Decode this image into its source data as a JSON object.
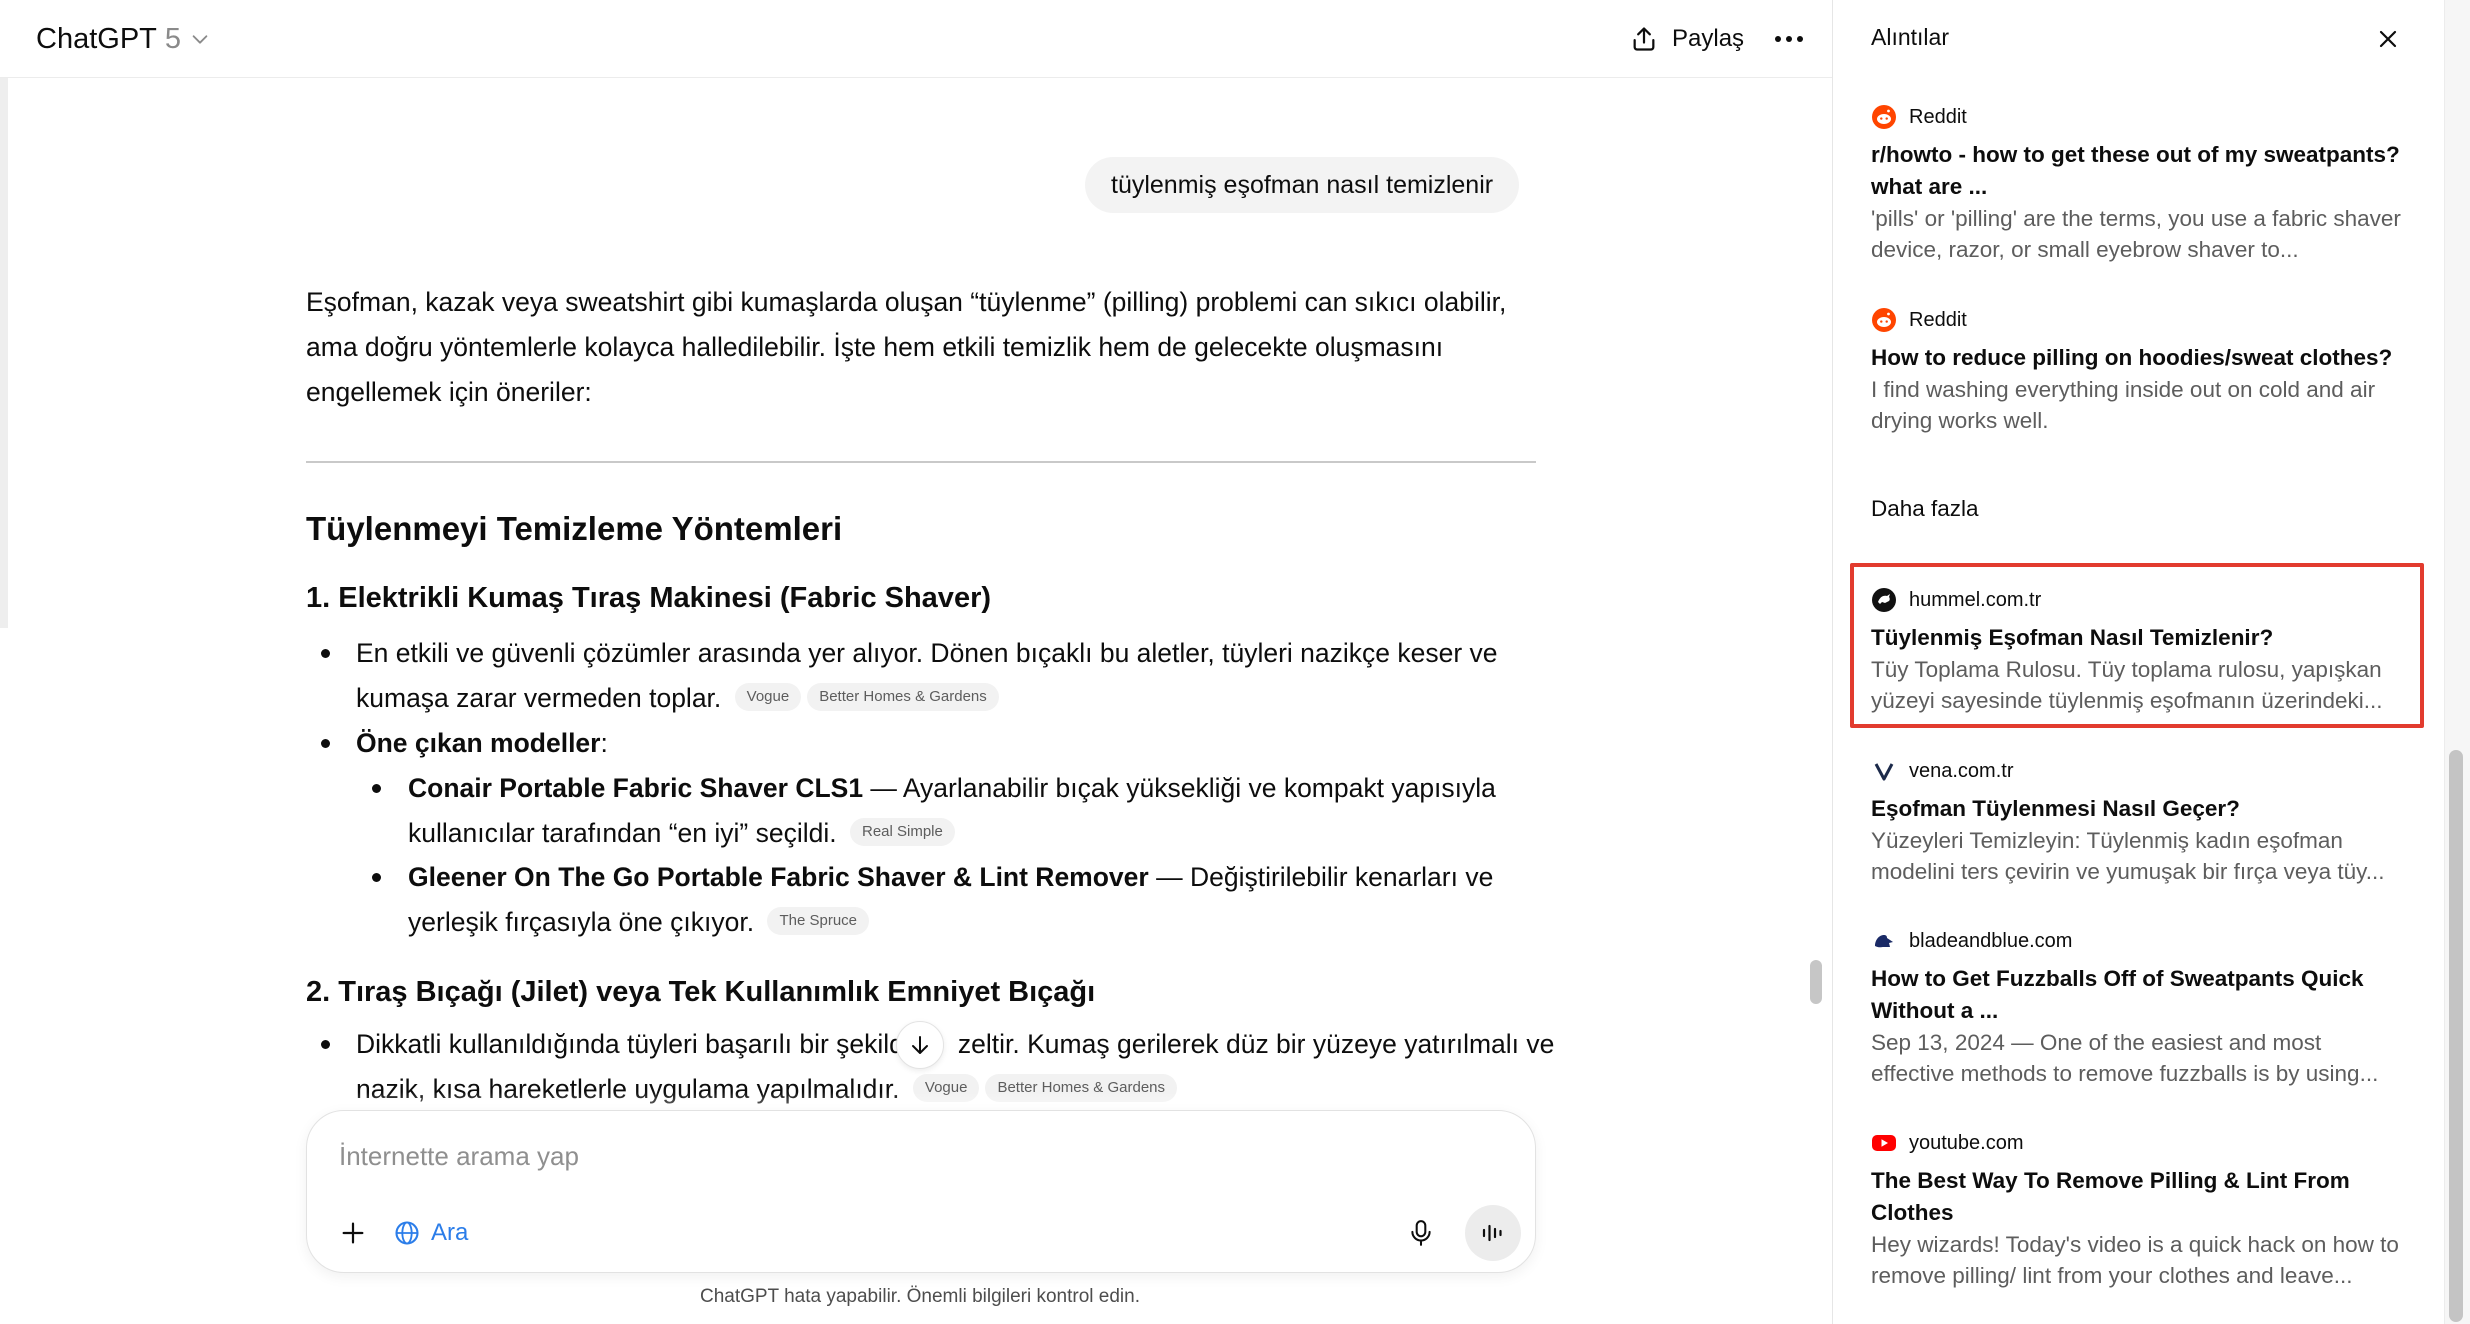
{
  "header": {
    "app_name": "ChatGPT",
    "model_version": "5",
    "share_label": "Paylaş"
  },
  "conversation": {
    "user_message": "tüylenmiş eşofman nasıl temizlenir",
    "intro_lines": [
      "Eşofman, kazak veya sweatshirt gibi kumaşlarda oluşan “tüylenme” (pilling) problemi can sıkıcı olabilir,",
      "ama doğru yöntemlerle kolayca halledilebilir. İşte hem etkili temizlik hem de gelecekte oluşmasını",
      "engellemek için öneriler:"
    ],
    "section_heading": "Tüylenmeyi Temizleme Yöntemleri",
    "method1": {
      "heading": "1. Elektrikli Kumaş Tıraş Makinesi (Fabric Shaver)",
      "bullet1_line1": "En etkili ve güvenli çözümler arasında yer alıyor. Dönen bıçaklı bu aletler, tüyleri nazikçe keser ve",
      "bullet1_line2": "kumaşa zarar vermeden toplar.",
      "bullet1_chips": [
        "Vogue",
        "Better Homes & Gardens"
      ],
      "bullet2_bold": "Öne çıkan modeller",
      "bullet2_rest": ":",
      "sub1_bold": "Conair Portable Fabric Shaver CLS1",
      "sub1_line1_rest": " — Ayarlanabilir bıçak yüksekliği ve kompakt yapısıyla",
      "sub1_line2": "kullanıcılar tarafından “en iyi” seçildi.",
      "sub1_chip": "Real Simple",
      "sub2_bold": "Gleener On The Go Portable Fabric Shaver & Lint Remover",
      "sub2_line1_rest": " — Değiştirilebilir kenarları ve",
      "sub2_line2": "yerleşik fırçasıyla öne çıkıyor.",
      "sub2_chip": "The Spruce"
    },
    "method2": {
      "heading": "2. Tıraş Bıçağı (Jilet) veya Tek Kullanımlık Emniyet Bıçağı",
      "bullet1_line1a": "Dikkatli kullanıldığında tüyleri başarılı bir şekild",
      "bullet1_line1b": "zeltir. Kumaş gerilerek düz bir yüzeye yatırılmalı ve",
      "bullet1_line2": "nazik, kısa hareketlerle uygulama yapılmalıdır.",
      "bullet1_chips": [
        "Vogue",
        "Better Homes & Gardens"
      ]
    }
  },
  "composer": {
    "placeholder": "İnternette arama yap",
    "search_label": "Ara"
  },
  "disclaimer": "ChatGPT hata yapabilir. Önemli bilgileri kontrol edin.",
  "citations_panel": {
    "title": "Alıntılar",
    "more_heading": "Daha fazla",
    "top_items": [
      {
        "source": "Reddit",
        "icon": "reddit-icon",
        "title": "r/howto - how to get these out of my sweatpants? what are ...",
        "snippet": "'pills' or 'pilling' are the terms, you use a fabric shaver device, razor, or small eyebrow shaver to..."
      },
      {
        "source": "Reddit",
        "icon": "reddit-icon",
        "title": "How to reduce pilling on hoodies/sweat clothes?",
        "snippet": "I find washing everything inside out on cold and air drying works well."
      }
    ],
    "more_items": [
      {
        "source": "hummel.com.tr",
        "icon": "hummel-icon",
        "title": "Tüylenmiş Eşofman Nasıl Temizlenir?",
        "snippet": "Tüy Toplama Rulosu. Tüy toplama rulosu, yapışkan yüzeyi sayesinde tüylenmiş eşofmanın üzerindeki...",
        "highlighted": true
      },
      {
        "source": "vena.com.tr",
        "icon": "vena-icon",
        "title": "Eşofman Tüylenmesi Nasıl Geçer?",
        "snippet": "Yüzeyleri Temizleyin: Tüylenmiş kadın eşofman modelini ters çevirin ve yumuşak bir fırça veya tüy..."
      },
      {
        "source": "bladeandblue.com",
        "icon": "bladeandblue-icon",
        "title": "How to Get Fuzzballs Off of Sweatpants Quick Without a ...",
        "snippet": "Sep 13, 2024 — One of the easiest and most effective methods to remove fuzzballs is by using..."
      },
      {
        "source": "youtube.com",
        "icon": "youtube-icon",
        "title": "The Best Way To Remove Pilling & Lint From Clothes",
        "snippet": "Hey wizards! Today's video is a quick hack on how to remove pilling/ lint from your clothes and leave..."
      }
    ]
  },
  "colors": {
    "highlight_border": "#e23b2e",
    "search_accent": "#2b7de9",
    "reddit": "#ff4500",
    "youtube": "#ff0000"
  }
}
